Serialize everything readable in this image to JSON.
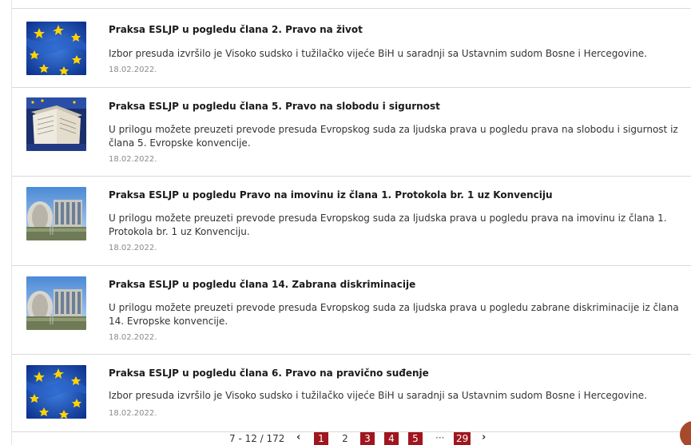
{
  "articles": [
    {
      "title": "Praksa ESLJP u pogledu člana 2. Pravo na život",
      "desc": "Izbor presuda izvršilo je Visoko sudsko i tužilačko vijeće BiH u saradnji sa Ustavnim sudom Bosne i Hercegovine.",
      "date": "18.02.2022.",
      "image": "eu-flag-image"
    },
    {
      "title": "Praksa ESLJP u pogledu člana 5. Pravo na slobodu i sigurnost",
      "desc": "U prilogu možete preuzeti prevode presuda Evropskog suda za ljudska prava u pogledu prava na slobodu i sigurnost iz člana 5. Evropske konvencije.",
      "date": "18.02.2022.",
      "image": "convention-book-image"
    },
    {
      "title": "Praksa ESLJP u pogledu Pravo na imovinu iz člana 1. Protokola br. 1 uz Konvenciju",
      "desc": "U prilogu možete preuzeti prevode presuda Evropskog suda za ljudska prava u pogledu prava na imovinu iz člana 1. Protokola br. 1 uz Konvenciju.",
      "date": "18.02.2022.",
      "image": "court-building-image"
    },
    {
      "title": "Praksa ESLJP u pogledu člana 14. Zabrana diskriminacije",
      "desc": "U prilogu možete preuzeti prevode presuda Evropskog suda za ljudska prava u pogledu zabrane diskriminacije iz člana 14. Evropske konvencije.",
      "date": "18.02.2022.",
      "image": "court-building-image"
    },
    {
      "title": "Praksa ESLJP u pogledu člana 6. Pravo na pravično suđenje",
      "desc": "Izbor presuda izvršilo je Visoko sudsko i tužilačko vijeće BiH u saradnji sa Ustavnim sudom Bosne i Hercegovine.",
      "date": "18.02.2022.",
      "image": "eu-flag-image"
    }
  ],
  "pagination": {
    "info": "7 - 12 / 172",
    "prev": "‹",
    "next": "›",
    "pages": [
      "1",
      "2",
      "3",
      "4",
      "5"
    ],
    "ellipsis": "···",
    "last": "29",
    "active_page": "2",
    "highlight_color": "#a0161e"
  }
}
